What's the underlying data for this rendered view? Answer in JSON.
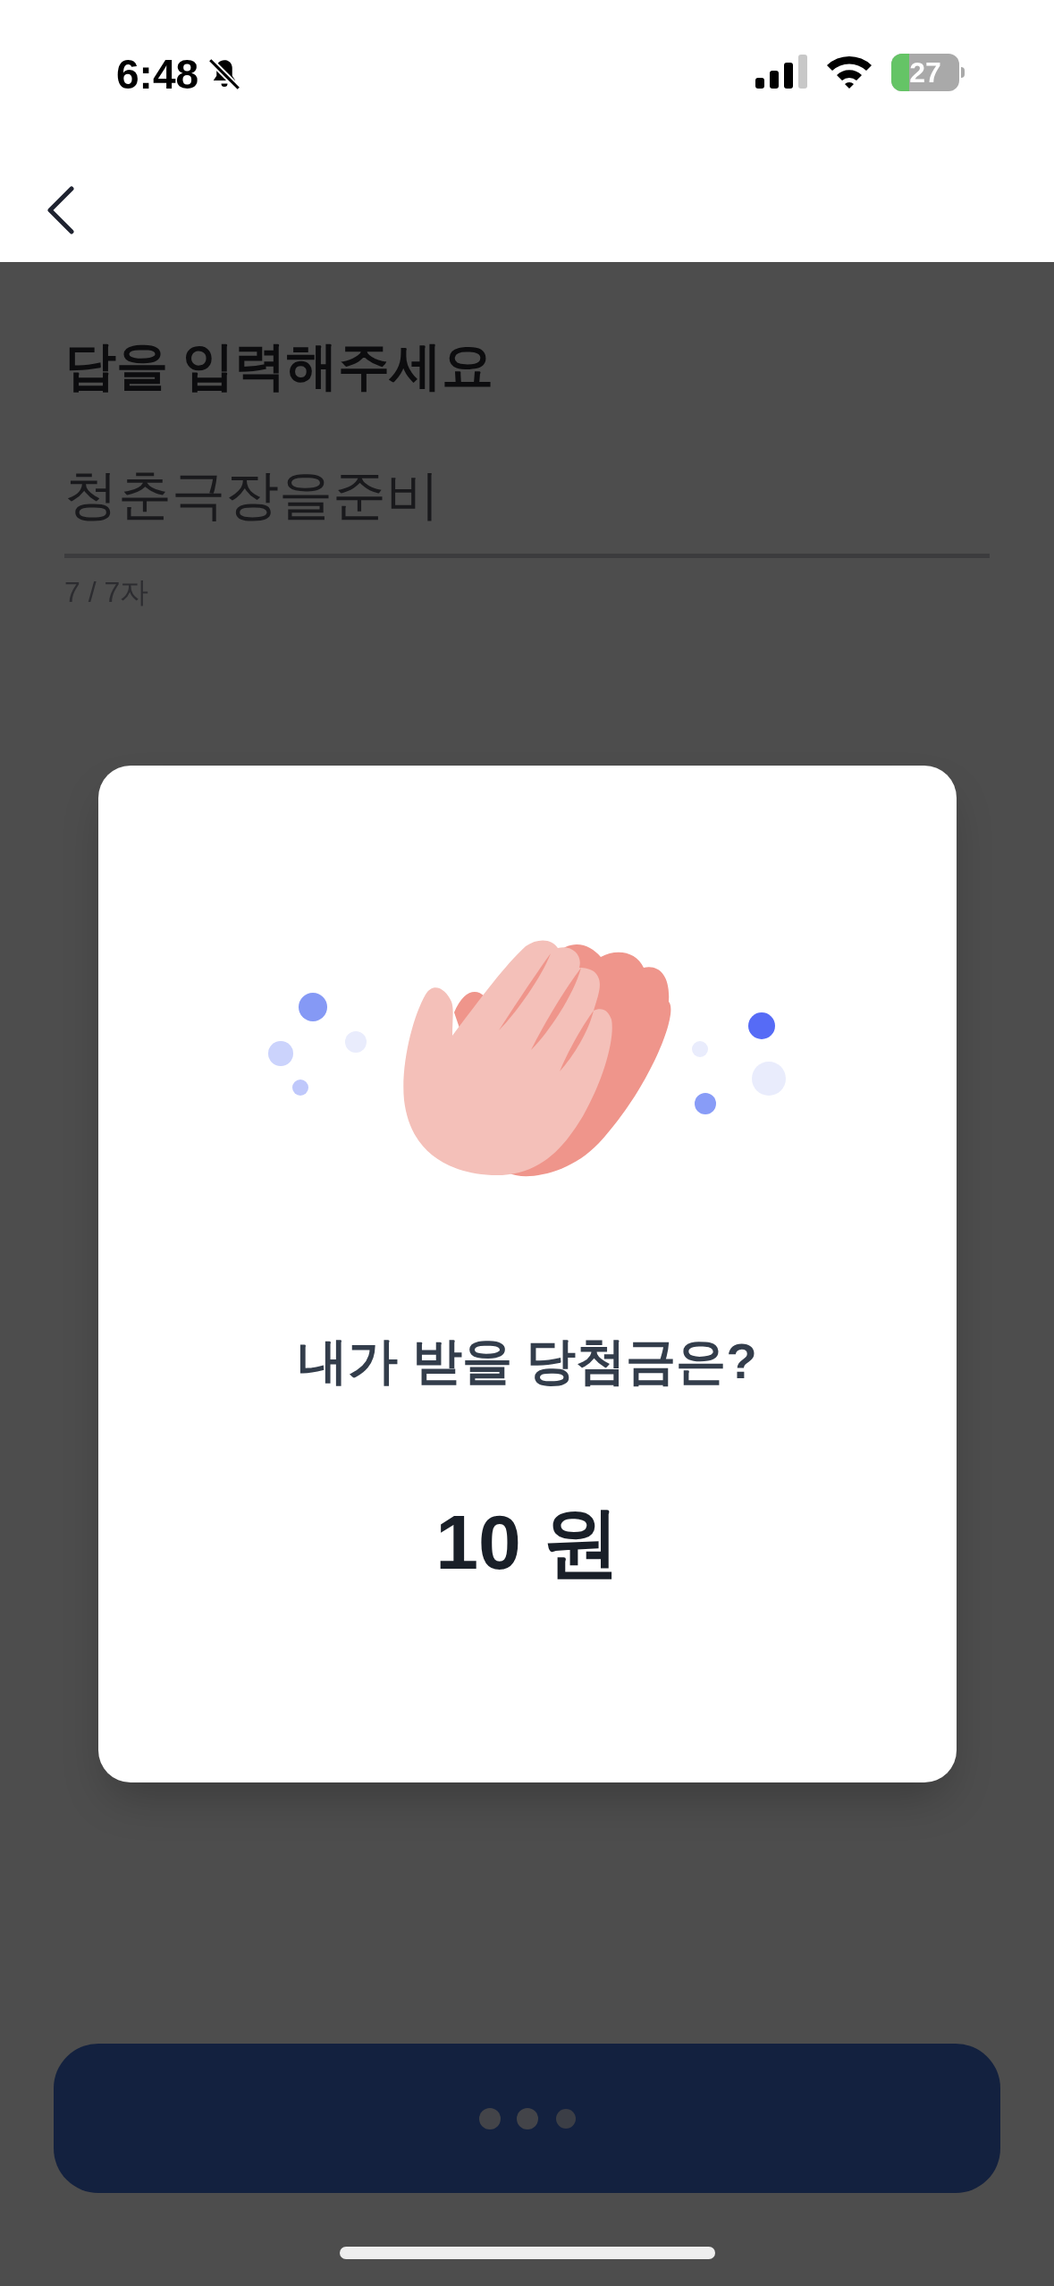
{
  "status_bar": {
    "time": "6:48",
    "battery": "27"
  },
  "title": "답을 입력해주세요",
  "answer_field": {
    "value": "청춘극장을준비",
    "counter": "7 / 7자"
  },
  "modal": {
    "question": "내가 받을 당첨금은?",
    "amount": "10 원"
  }
}
